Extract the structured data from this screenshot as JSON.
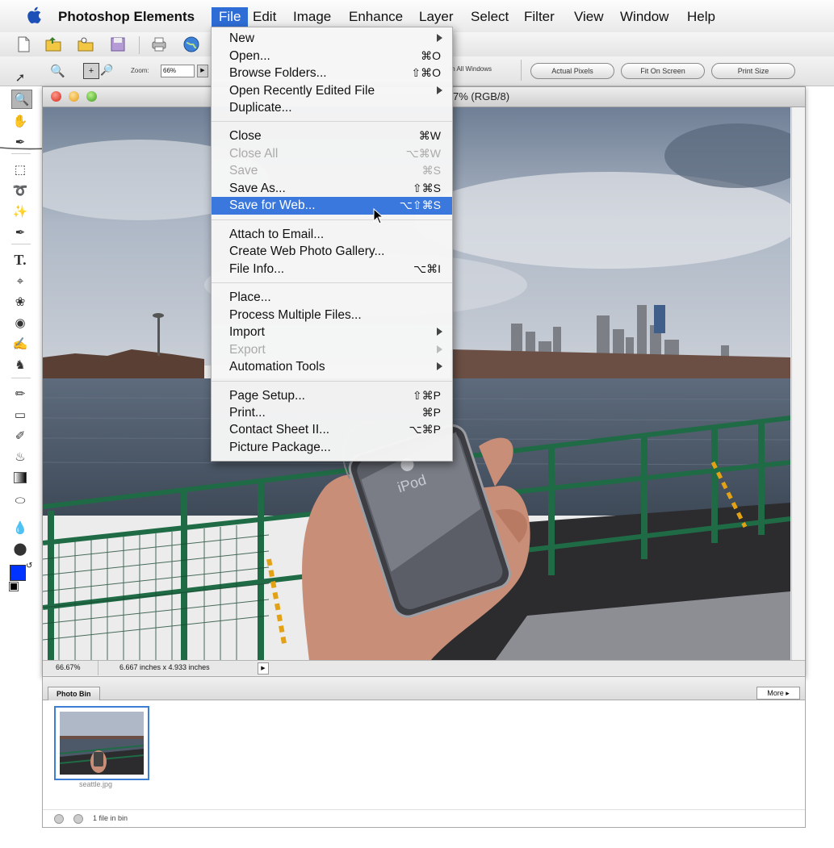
{
  "menubar": {
    "app_name": "Photoshop Elements",
    "items": [
      "File",
      "Edit",
      "Image",
      "Enhance",
      "Layer",
      "Select",
      "Filter",
      "View",
      "Window",
      "Help"
    ],
    "active": "File"
  },
  "options": {
    "zoom_label": "Zoom:",
    "zoom_value": "66%",
    "all_windows_label": "m All Windows",
    "actual_pixels": "Actual Pixels",
    "fit_on_screen": "Fit On Screen",
    "print_size": "Print Size"
  },
  "document": {
    "title_suffix": "7% (RGB/8)",
    "zoom_status": "66.67%",
    "dimensions": "6.667 inches x 4.933 inches"
  },
  "file_menu": [
    {
      "label": "New",
      "shortcut": "",
      "submenu": true,
      "disabled": false
    },
    {
      "label": "Open...",
      "shortcut": "⌘O",
      "submenu": false,
      "disabled": false
    },
    {
      "label": "Browse Folders...",
      "shortcut": "⇧⌘O",
      "submenu": false,
      "disabled": false
    },
    {
      "label": "Open Recently Edited File",
      "shortcut": "",
      "submenu": true,
      "disabled": false
    },
    {
      "label": "Duplicate...",
      "shortcut": "",
      "submenu": false,
      "disabled": false
    },
    {
      "label": "Close",
      "shortcut": "⌘W",
      "submenu": false,
      "disabled": false
    },
    {
      "label": "Close All",
      "shortcut": "⌥⌘W",
      "submenu": false,
      "disabled": true
    },
    {
      "label": "Save",
      "shortcut": "⌘S",
      "submenu": false,
      "disabled": true
    },
    {
      "label": "Save As...",
      "shortcut": "⇧⌘S",
      "submenu": false,
      "disabled": false
    },
    {
      "label": "Save for Web...",
      "shortcut": "⌥⇧⌘S",
      "submenu": false,
      "disabled": false,
      "highlighted": true
    },
    {
      "label": "Attach to Email...",
      "shortcut": "",
      "submenu": false,
      "disabled": false
    },
    {
      "label": "Create Web Photo Gallery...",
      "shortcut": "",
      "submenu": false,
      "disabled": false
    },
    {
      "label": "File Info...",
      "shortcut": "⌥⌘I",
      "submenu": false,
      "disabled": false
    },
    {
      "label": "Place...",
      "shortcut": "",
      "submenu": false,
      "disabled": false
    },
    {
      "label": "Process Multiple Files...",
      "shortcut": "",
      "submenu": false,
      "disabled": false
    },
    {
      "label": "Import",
      "shortcut": "",
      "submenu": true,
      "disabled": false
    },
    {
      "label": "Export",
      "shortcut": "",
      "submenu": true,
      "disabled": true
    },
    {
      "label": "Automation Tools",
      "shortcut": "",
      "submenu": true,
      "disabled": false
    },
    {
      "label": "Page Setup...",
      "shortcut": "⇧⌘P",
      "submenu": false,
      "disabled": false
    },
    {
      "label": "Print...",
      "shortcut": "⌘P",
      "submenu": false,
      "disabled": false
    },
    {
      "label": "Contact Sheet II...",
      "shortcut": "⌥⌘P",
      "submenu": false,
      "disabled": false
    },
    {
      "label": "Picture Package...",
      "shortcut": "",
      "submenu": false,
      "disabled": false
    }
  ],
  "photo_bin": {
    "tab_label": "Photo Bin",
    "more_label": "More",
    "thumbnail_caption": "seattle.jpg",
    "file_count": "1 file in bin"
  },
  "colors": {
    "menu_highlight": "#3b78de",
    "foreground_swatch": "#0033ff"
  }
}
